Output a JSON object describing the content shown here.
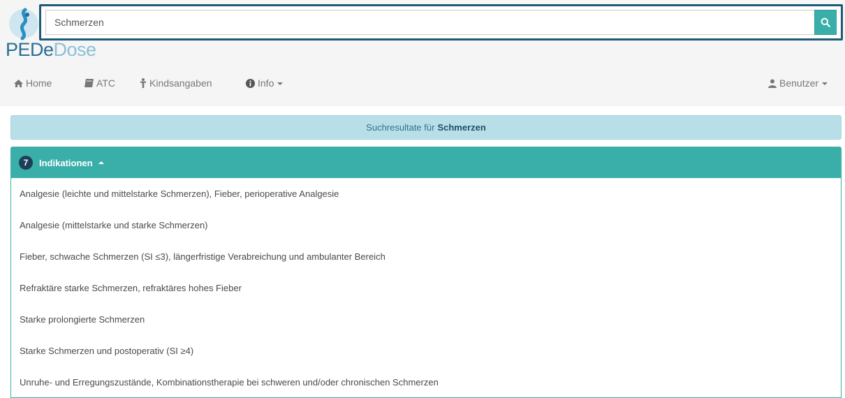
{
  "search": {
    "value": "Schmerzen",
    "button_icon": "search-icon"
  },
  "brand": {
    "part1": "PEDe",
    "part2": "Dose",
    "logo_icon": "pededose-logo-icon"
  },
  "nav": {
    "home": {
      "label": "Home",
      "icon": "home-icon"
    },
    "atc": {
      "label": "ATC",
      "icon": "book-icon"
    },
    "kind": {
      "label": "Kindsangaben",
      "icon": "child-icon"
    },
    "info": {
      "label": "Info",
      "icon": "info-icon"
    },
    "user": {
      "label": "Benutzer",
      "icon": "user-icon"
    }
  },
  "results": {
    "prefix": "Suchresultate für",
    "term": "Schmerzen"
  },
  "panel": {
    "count": "7",
    "title": "Indikationen",
    "items": [
      "Analgesie (leichte und mittelstarke Schmerzen), Fieber, perioperative Analgesie",
      "Analgesie (mittelstarke und starke Schmerzen)",
      "Fieber, schwache Schmerzen (SI ≤3), längerfristige Verabreichung und ambulanter Bereich",
      "Refraktäre starke Schmerzen, refraktäres hohes Fieber",
      "Starke prolongierte Schmerzen",
      "Starke Schmerzen und postoperativ (SI ≥4)",
      "Unruhe- und Erregungszustände, Kombinationstherapie bei schweren und/oder chronischen Schmerzen"
    ]
  },
  "colors": {
    "accent": "#3aafa9",
    "search_frame": "#1d5a78",
    "banner_bg": "#b8dfe8",
    "badge_bg": "#1e3f5a"
  }
}
